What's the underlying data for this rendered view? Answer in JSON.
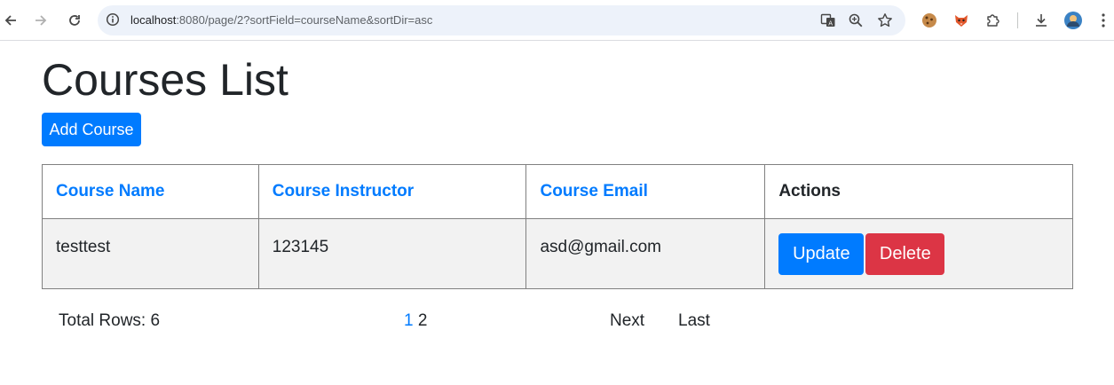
{
  "browser": {
    "url_host": "localhost",
    "url_rest": ":8080/page/2?sortField=courseName&sortDir=asc"
  },
  "page": {
    "title": "Courses List",
    "add_button": "Add Course"
  },
  "table": {
    "headers": {
      "course_name": "Course Name",
      "course_instructor": "Course Instructor",
      "course_email": "Course Email",
      "actions": "Actions"
    },
    "rows": [
      {
        "name": "testtest",
        "instructor": "123145",
        "email": "asd@gmail.com",
        "update": "Update",
        "delete": "Delete"
      }
    ]
  },
  "pagination": {
    "total_rows": "Total Rows: 6",
    "pages": [
      "1",
      "2"
    ],
    "current_page": "1",
    "next": "Next",
    "last": "Last"
  },
  "colors": {
    "primary": "#007bff",
    "danger": "#dc3545",
    "row_bg": "#f2f2f2"
  }
}
